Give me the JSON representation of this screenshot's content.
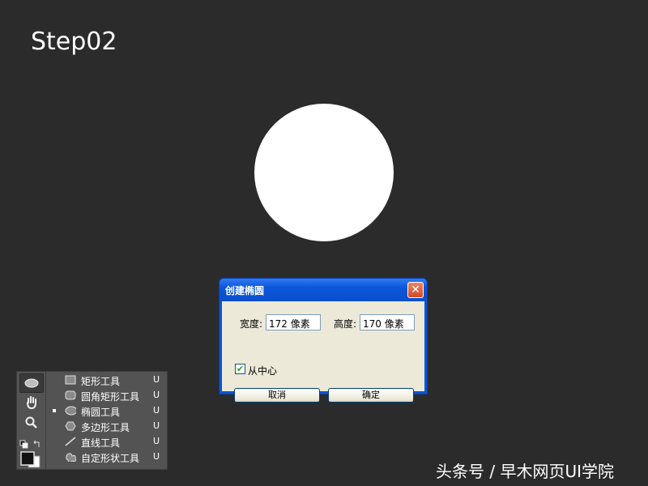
{
  "step_title": "Step02",
  "dialog": {
    "title": "创建椭圆",
    "close_glyph": "✕",
    "width_label": "宽度:",
    "width_value": "172 像素",
    "height_label": "高度:",
    "height_value": "170 像素",
    "from_center_label": "从中心",
    "from_center_checked": true,
    "cancel_label": "取消",
    "ok_label": "确定"
  },
  "toolbox": {
    "tools": [
      {
        "name": "矩形工具",
        "key": "U",
        "icon": "rectangle-icon",
        "selected": false
      },
      {
        "name": "圆角矩形工具",
        "key": "U",
        "icon": "rounded-rectangle-icon",
        "selected": false
      },
      {
        "name": "椭圆工具",
        "key": "U",
        "icon": "ellipse-icon",
        "selected": true
      },
      {
        "name": "多边形工具",
        "key": "U",
        "icon": "polygon-icon",
        "selected": false
      },
      {
        "name": "直线工具",
        "key": "U",
        "icon": "line-icon",
        "selected": false
      },
      {
        "name": "自定形状工具",
        "key": "U",
        "icon": "custom-shape-icon",
        "selected": false
      }
    ]
  },
  "watermark": "头条号 / 早木网页UI学院",
  "colors": {
    "background": "#2b2b2b",
    "dialog_blue": "#0a54d8",
    "dialog_body": "#ece9d8",
    "panel": "#535353"
  }
}
